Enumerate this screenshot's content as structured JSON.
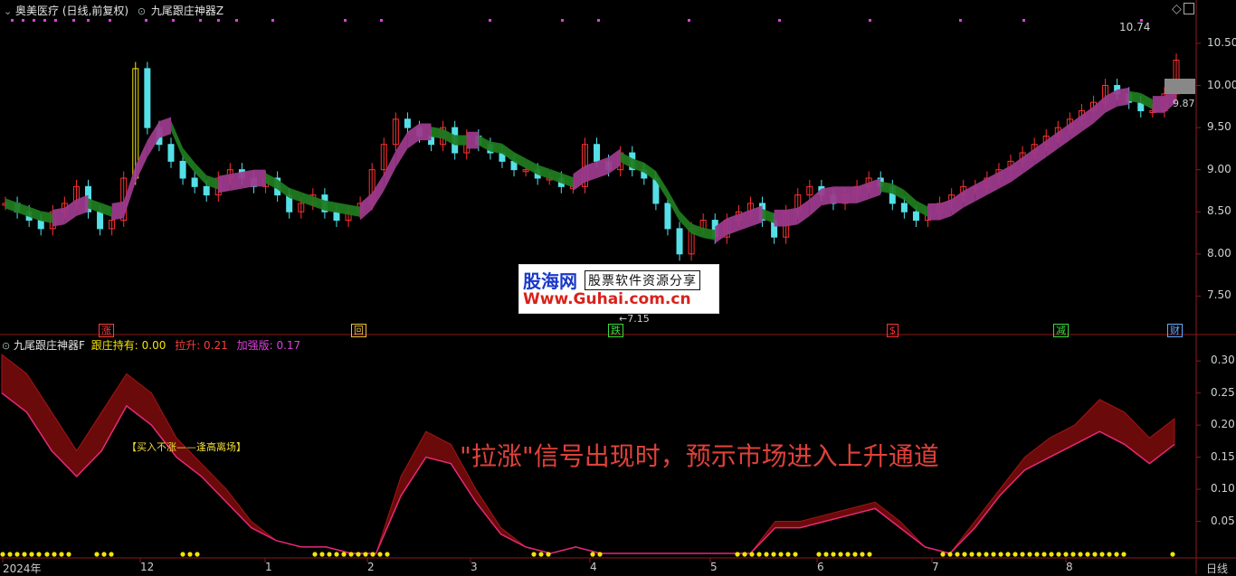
{
  "header": {
    "stock_title": "奥美医疗 (日线,前复权)",
    "indicator_name": "九尾跟庄神器Z"
  },
  "sub_header": {
    "indicator_name": "九尾跟庄神器F",
    "holding_label": "跟庄持有: 0.00",
    "rise_label": "拉升: 0.21",
    "boost_label": "加强版: 0.17"
  },
  "annotations": {
    "high_label": "10.74",
    "current_label": "9.87",
    "low_label": "←7.15",
    "main_note": "\"拉涨\"信号出现时，预示市场进入上升通道",
    "small_note": "【买入不涨——逢高离场】"
  },
  "signals": [
    {
      "text": "涨",
      "color": "#ff3c3c"
    },
    {
      "text": "回",
      "color": "#f0c040"
    },
    {
      "text": "跌",
      "color": "#3cdc3c"
    },
    {
      "text": "$",
      "color": "#ff3030"
    },
    {
      "text": "减",
      "color": "#3cdc3c"
    },
    {
      "text": "财",
      "color": "#66aaff"
    }
  ],
  "watermark": {
    "brand": "股海网",
    "slogan": "股票软件资源分享",
    "url": "Www.Guhai.com.cn"
  },
  "bottom_bar": {
    "period_label": "日线"
  },
  "colors": {
    "up": "#ff3030",
    "down": "#55e0e8",
    "limit_up": "#f5e400",
    "band_purple": "#9b3a8c",
    "band_green": "#1f7a1f",
    "osc_fill": "#6b0a0a",
    "osc_line": "#e6287a",
    "dots": "#f5e400"
  },
  "chart_data": [
    {
      "type": "candlestick",
      "title": "奥美医疗 (日线,前复权)",
      "y_axis_ticks": [
        "10.50",
        "10.00",
        "9.50",
        "9.00",
        "8.50",
        "8.00",
        "7.50"
      ],
      "ylim": [
        7.15,
        10.8
      ],
      "x_tick_labels": [
        "2024年",
        "12",
        "1",
        "2",
        "3",
        "4",
        "5",
        "6",
        "7",
        "8"
      ],
      "high": 10.74,
      "low": 7.15,
      "last": 9.87,
      "close_series": [
        8.6,
        8.5,
        8.4,
        8.3,
        8.5,
        8.6,
        8.8,
        8.5,
        8.3,
        8.4,
        8.9,
        10.2,
        9.5,
        9.3,
        9.1,
        8.9,
        8.8,
        8.7,
        8.9,
        9.0,
        8.9,
        8.8,
        8.9,
        8.7,
        8.5,
        8.6,
        8.7,
        8.5,
        8.4,
        8.5,
        8.6,
        9.0,
        9.3,
        9.6,
        9.5,
        9.4,
        9.3,
        9.5,
        9.2,
        9.4,
        9.3,
        9.2,
        9.1,
        9.0,
        9.0,
        8.9,
        8.9,
        8.8,
        8.8,
        9.3,
        9.1,
        9.0,
        9.2,
        9.0,
        8.9,
        8.6,
        8.3,
        8.0,
        8.3,
        8.4,
        8.2,
        8.4,
        8.5,
        8.6,
        8.4,
        8.2,
        8.5,
        8.7,
        8.8,
        8.7,
        8.6,
        8.7,
        8.8,
        8.9,
        8.8,
        8.6,
        8.5,
        8.4,
        8.5,
        8.6,
        8.7,
        8.8,
        8.8,
        8.9,
        9.0,
        9.1,
        9.2,
        9.3,
        9.4,
        9.5,
        9.6,
        9.7,
        9.8,
        10.0,
        9.9,
        9.8,
        9.7,
        9.7,
        9.9,
        10.3
      ]
    },
    {
      "type": "area",
      "title": "九尾跟庄神器F",
      "y_axis_ticks": [
        "0.30",
        "0.25",
        "0.20",
        "0.15",
        "0.10",
        "0.05"
      ],
      "ylim": [
        0,
        0.32
      ],
      "series": [
        {
          "name": "拉升",
          "values": [
            0.31,
            0.28,
            0.22,
            0.16,
            0.22,
            0.28,
            0.25,
            0.18,
            0.14,
            0.1,
            0.05,
            0.02,
            0.01,
            0.01,
            0.0,
            0.0,
            0.12,
            0.19,
            0.17,
            0.1,
            0.04,
            0.01,
            0.0,
            0.01,
            0.0,
            0.0,
            0.0,
            0.0,
            0.0,
            0.0,
            0.0,
            0.05,
            0.05,
            0.06,
            0.07,
            0.08,
            0.05,
            0.01,
            0.0,
            0.05,
            0.1,
            0.15,
            0.18,
            0.2,
            0.24,
            0.22,
            0.18,
            0.21
          ]
        },
        {
          "name": "加强版",
          "values": [
            0.25,
            0.22,
            0.16,
            0.12,
            0.16,
            0.23,
            0.2,
            0.15,
            0.12,
            0.08,
            0.04,
            0.02,
            0.01,
            0.01,
            0.0,
            0.0,
            0.09,
            0.15,
            0.14,
            0.08,
            0.03,
            0.01,
            0.0,
            0.01,
            0.0,
            0.0,
            0.0,
            0.0,
            0.0,
            0.0,
            0.0,
            0.04,
            0.04,
            0.05,
            0.06,
            0.07,
            0.04,
            0.01,
            0.0,
            0.04,
            0.09,
            0.13,
            0.15,
            0.17,
            0.19,
            0.17,
            0.14,
            0.17
          ]
        }
      ]
    }
  ]
}
